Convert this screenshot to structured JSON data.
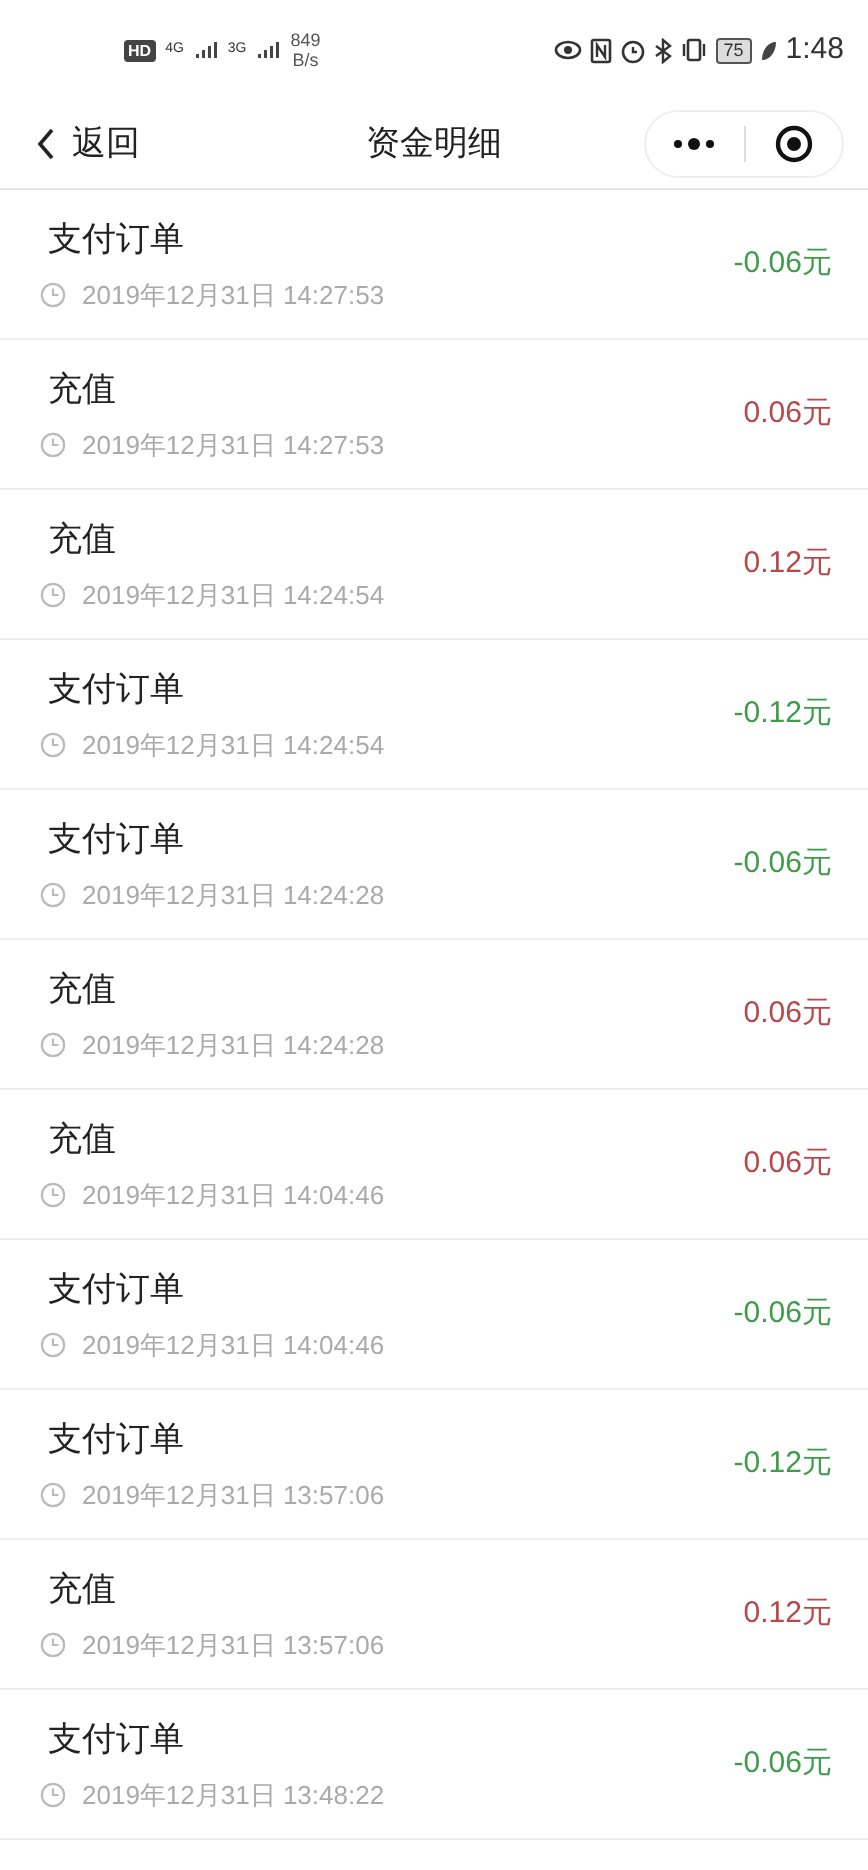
{
  "status_bar": {
    "hd": "HD",
    "net1": "4G",
    "net2": "3G",
    "speed": "849",
    "speed_unit": "B/s",
    "battery": "75",
    "time": "1:48"
  },
  "header": {
    "back": "返回",
    "title": "资金明细"
  },
  "records": [
    {
      "title": "支付订单",
      "time": "2019年12月31日 14:27:53",
      "amount": "-0.06元",
      "kind": "expense"
    },
    {
      "title": "充值",
      "time": "2019年12月31日 14:27:53",
      "amount": "0.06元",
      "kind": "income"
    },
    {
      "title": "充值",
      "time": "2019年12月31日 14:24:54",
      "amount": "0.12元",
      "kind": "income"
    },
    {
      "title": "支付订单",
      "time": "2019年12月31日 14:24:54",
      "amount": "-0.12元",
      "kind": "expense"
    },
    {
      "title": "支付订单",
      "time": "2019年12月31日 14:24:28",
      "amount": "-0.06元",
      "kind": "expense"
    },
    {
      "title": "充值",
      "time": "2019年12月31日 14:24:28",
      "amount": "0.06元",
      "kind": "income"
    },
    {
      "title": "充值",
      "time": "2019年12月31日 14:04:46",
      "amount": "0.06元",
      "kind": "income"
    },
    {
      "title": "支付订单",
      "time": "2019年12月31日 14:04:46",
      "amount": "-0.06元",
      "kind": "expense"
    },
    {
      "title": "支付订单",
      "time": "2019年12月31日 13:57:06",
      "amount": "-0.12元",
      "kind": "expense"
    },
    {
      "title": "充值",
      "time": "2019年12月31日 13:57:06",
      "amount": "0.12元",
      "kind": "income"
    },
    {
      "title": "支付订单",
      "time": "2019年12月31日 13:48:22",
      "amount": "-0.06元",
      "kind": "expense"
    }
  ]
}
